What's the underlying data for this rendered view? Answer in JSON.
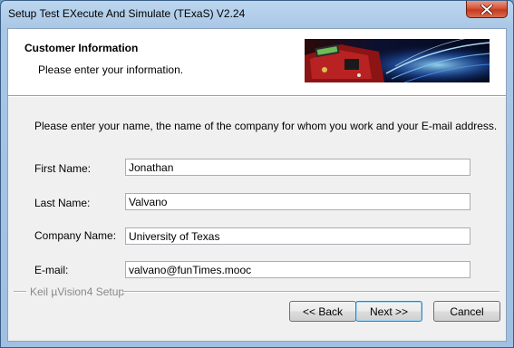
{
  "window": {
    "title": "Setup Test EXecute And Simulate (TExaS) V2.24"
  },
  "header": {
    "title": "Customer Information",
    "subtitle": "Please enter your information."
  },
  "instructions": "Please enter your name, the name of the company for whom you work and your E-mail address.",
  "fields": {
    "first_name": {
      "label": "First Name:",
      "value": "Jonathan"
    },
    "last_name": {
      "label": "Last Name:",
      "value": "Valvano"
    },
    "company": {
      "label": "Company Name:",
      "value": "University of Texas"
    },
    "email": {
      "label": "E-mail:",
      "value": "valvano@funTimes.mooc"
    }
  },
  "footer": {
    "group_label": "Keil µVision4 Setup"
  },
  "buttons": {
    "back": "<< Back",
    "next": "Next >>",
    "cancel": "Cancel"
  }
}
